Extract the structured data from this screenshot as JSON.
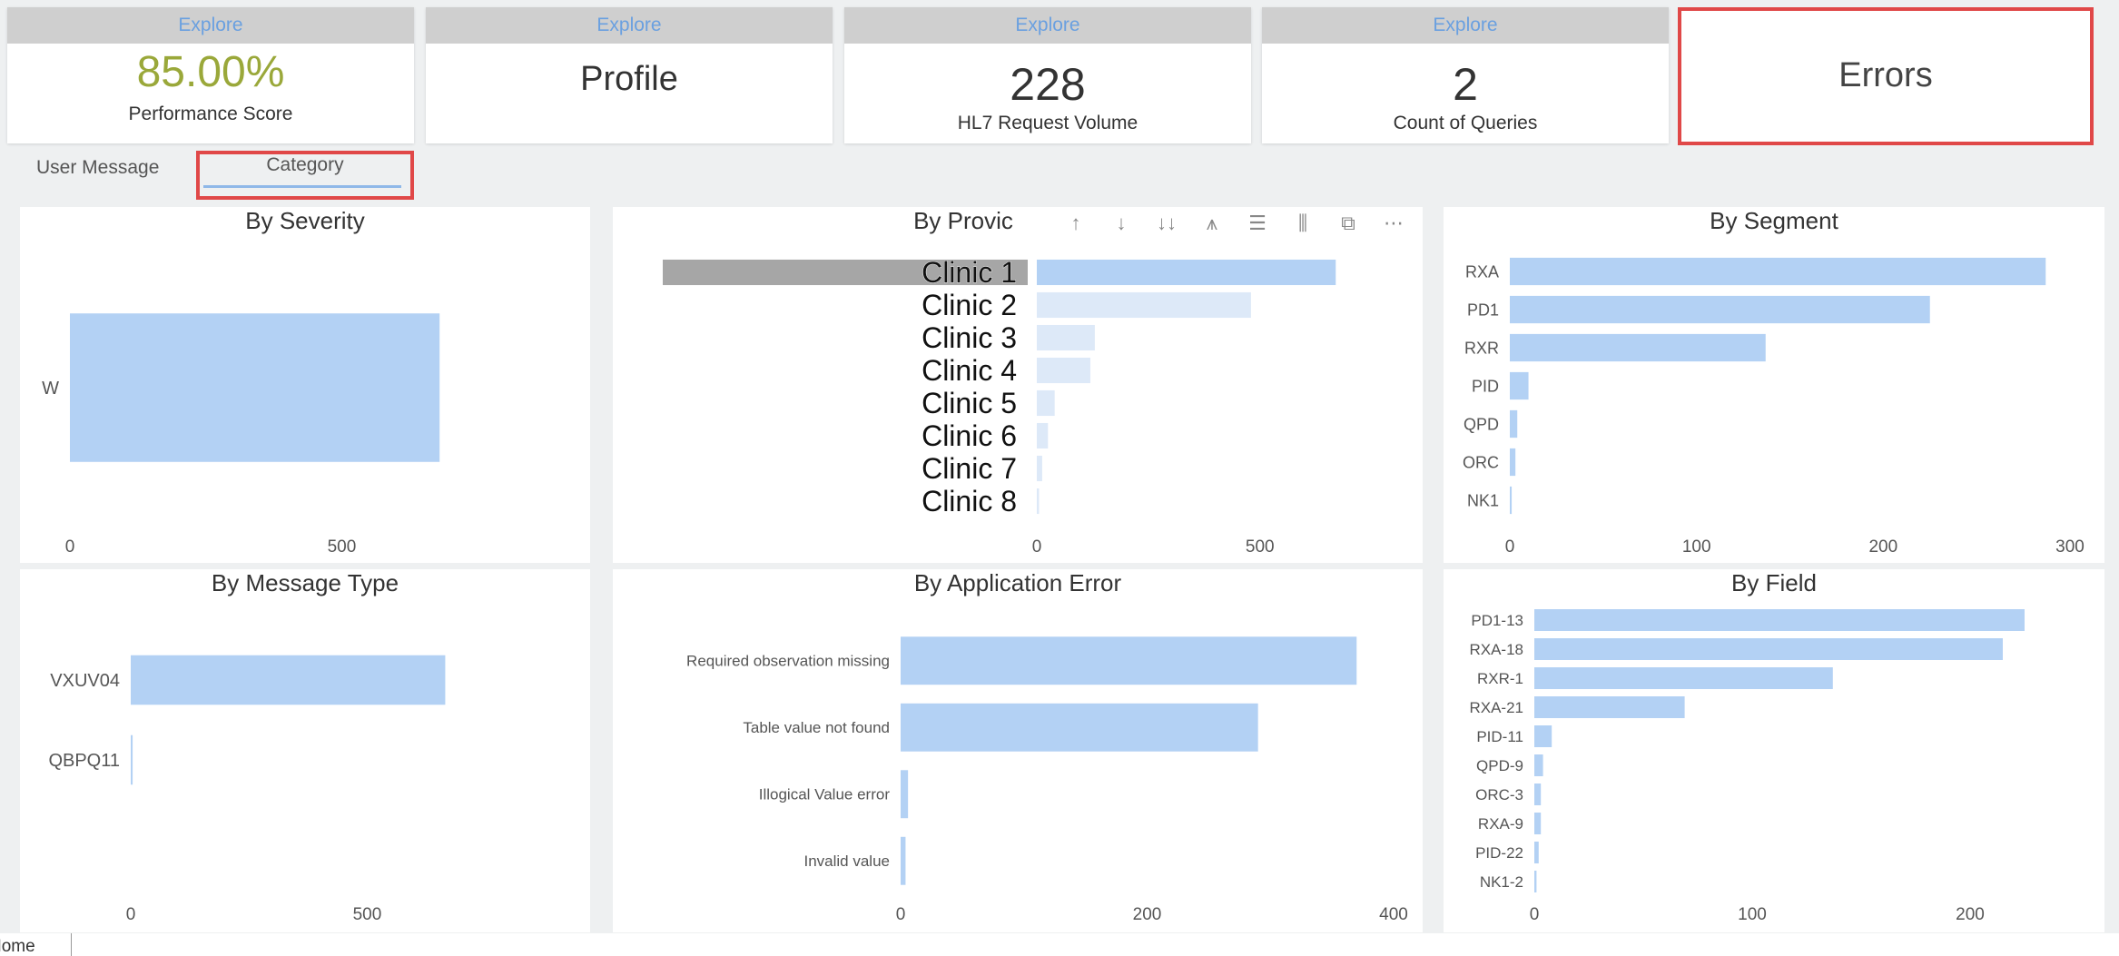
{
  "kpis": [
    {
      "explore": "Explore",
      "value": "85.00%",
      "label": "Performance Score",
      "value_color": "#9aa83a"
    },
    {
      "explore": "Explore",
      "value": "Profile",
      "label": ""
    },
    {
      "explore": "Explore",
      "value": "228",
      "label": "HL7 Request Volume"
    },
    {
      "explore": "Explore",
      "value": "2",
      "label": "Count of Queries"
    },
    {
      "explore": "",
      "value": "Errors",
      "label": ""
    }
  ],
  "tabs": [
    {
      "label": "User Message"
    },
    {
      "label": "Category"
    }
  ],
  "toolbar": {
    "icons": [
      "arrow-up-icon",
      "arrow-down-icon",
      "double-arrow-down-icon",
      "expand-hierarchy-icon",
      "filter-icon",
      "chart-edit-icon",
      "focus-mode-icon",
      "more-options-icon"
    ],
    "glyphs": [
      "↑",
      "↓",
      "↓↓",
      "⩚",
      "☰",
      "⫼",
      "⧉",
      "⋯"
    ]
  },
  "bottom_tab": "Home",
  "colors": {
    "bar": "#b3d1f4",
    "bar_light": "#dde9f8",
    "highlight_border": "#e04848",
    "selected_row": "#a6a6a6"
  },
  "chart_data": [
    {
      "type": "bar",
      "orientation": "horizontal",
      "title": "By Severity",
      "categories": [
        "W"
      ],
      "values": [
        680
      ],
      "xlim": [
        0,
        860
      ],
      "xticks": [
        0,
        500
      ]
    },
    {
      "type": "bar",
      "orientation": "horizontal",
      "title": "By Provic",
      "categories": [
        "Clinic 1",
        "Clinic 2",
        "Clinic 3",
        "Clinic 4",
        "Clinic 5",
        "Clinic 6",
        "Clinic 7",
        "Clinic 8"
      ],
      "values": [
        670,
        480,
        130,
        120,
        40,
        25,
        12,
        5
      ],
      "xlim": [
        0,
        820
      ],
      "xticks": [
        0,
        500
      ],
      "selected": "Clinic 1"
    },
    {
      "type": "bar",
      "orientation": "horizontal",
      "title": "By Segment",
      "categories": [
        "RXA",
        "PD1",
        "RXR",
        "PID",
        "QPD",
        "ORC",
        "NK1"
      ],
      "values": [
        287,
        225,
        137,
        10,
        4,
        3,
        1
      ],
      "xlim": [
        0,
        300
      ],
      "xticks": [
        0,
        100,
        200,
        300
      ]
    },
    {
      "type": "bar",
      "orientation": "horizontal",
      "title": "By Message Type",
      "categories": [
        "VXUV04",
        "QBPQ11"
      ],
      "values": [
        665,
        4
      ],
      "xlim": [
        0,
        860
      ],
      "xticks": [
        0,
        500
      ]
    },
    {
      "type": "bar",
      "orientation": "horizontal",
      "title": "By Application Error",
      "categories": [
        "Required observation missing",
        "Table value not found",
        "Illogical Value error",
        "Invalid value"
      ],
      "values": [
        370,
        290,
        6,
        4
      ],
      "xlim": [
        0,
        400
      ],
      "xticks": [
        0,
        200,
        400
      ]
    },
    {
      "type": "bar",
      "orientation": "horizontal",
      "title": "By Field",
      "categories": [
        "PD1-13",
        "RXA-18",
        "RXR-1",
        "RXA-21",
        "PID-11",
        "QPD-9",
        "ORC-3",
        "RXA-9",
        "PID-22",
        "NK1-2"
      ],
      "values": [
        225,
        215,
        137,
        69,
        8,
        4,
        3,
        3,
        2,
        1
      ],
      "xlim": [
        0,
        250
      ],
      "xticks": [
        0,
        100,
        200
      ]
    }
  ]
}
